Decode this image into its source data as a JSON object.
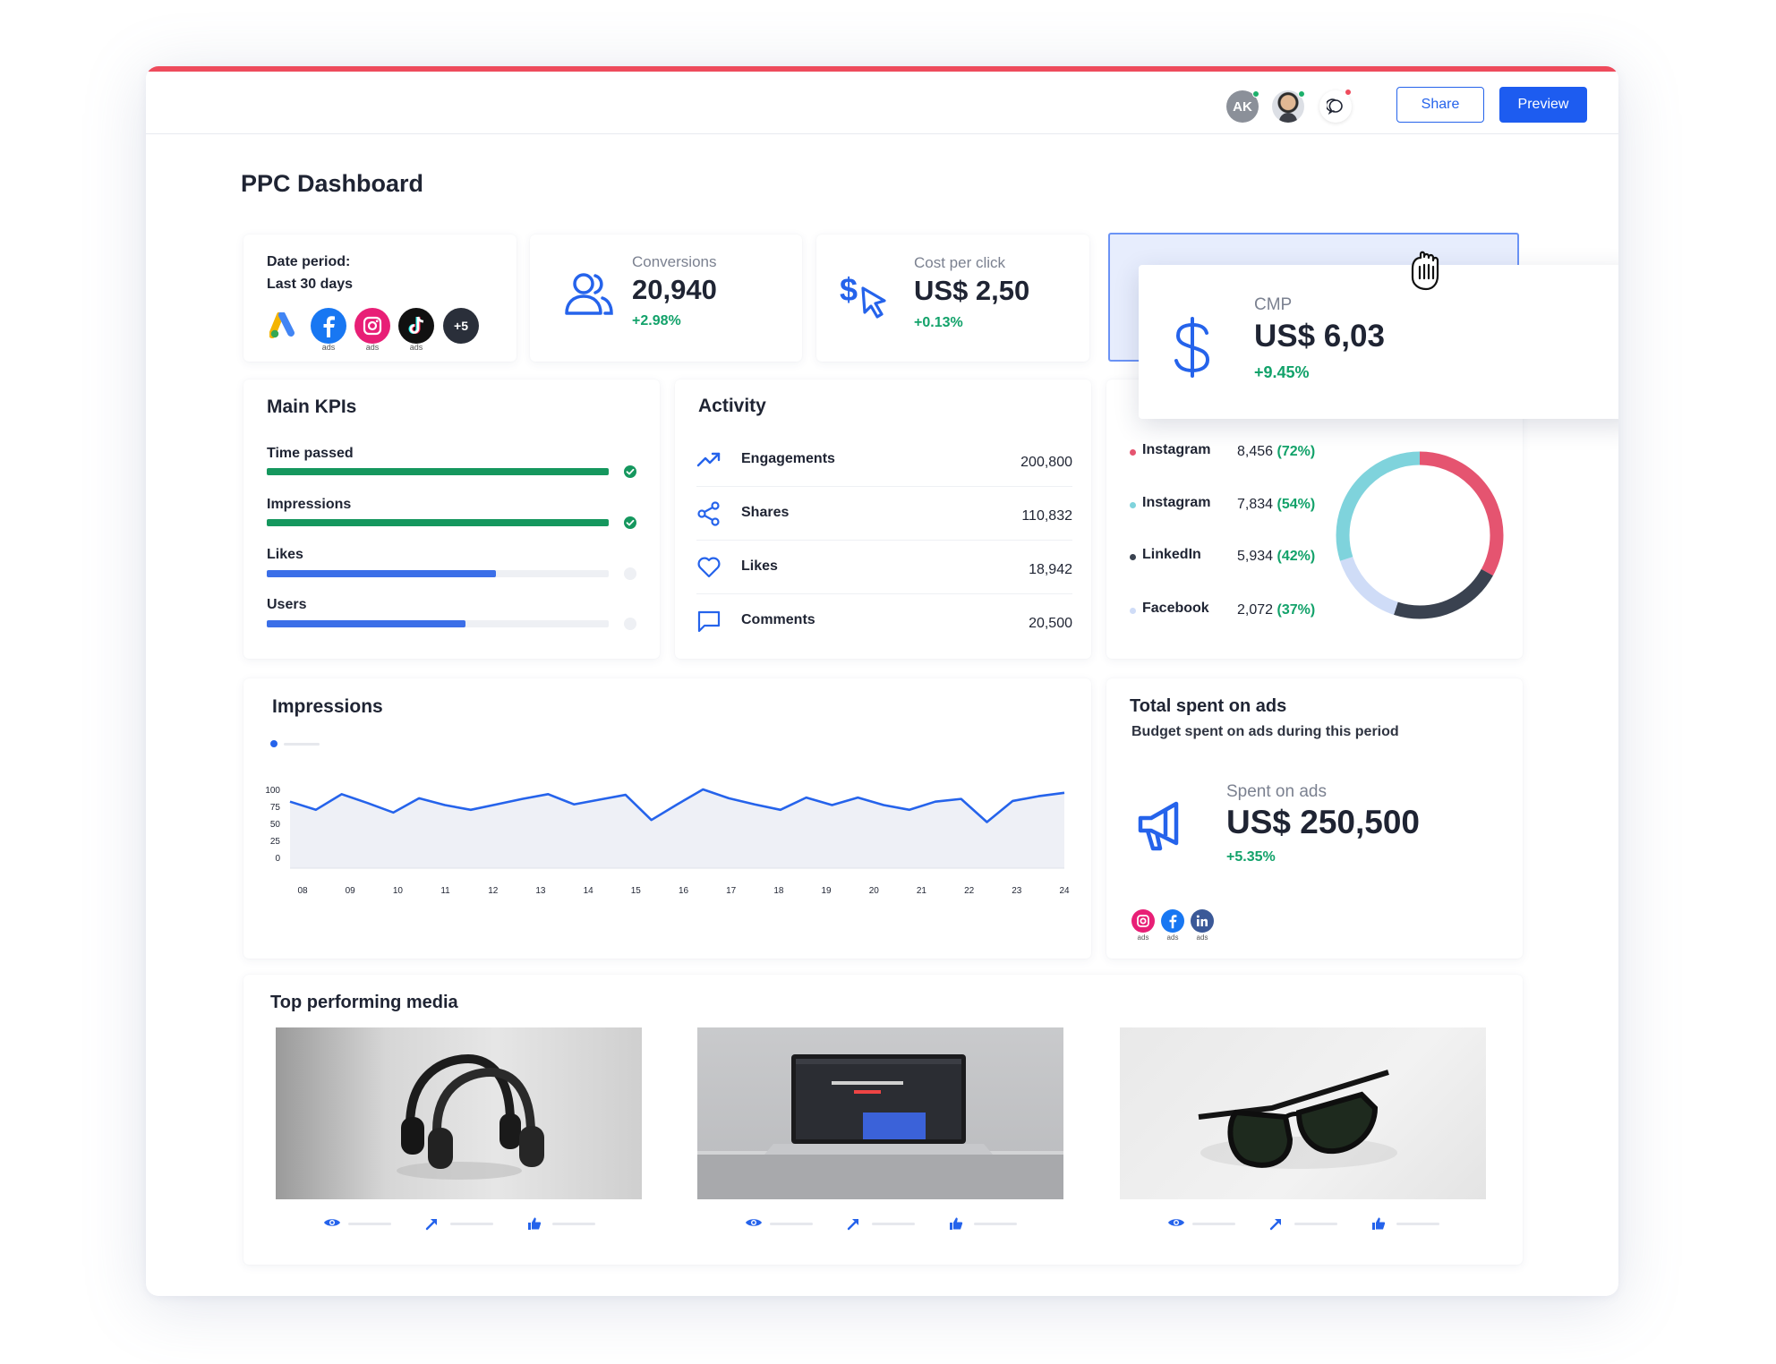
{
  "topbar": {
    "avatar_initials": "AK",
    "share_label": "Share",
    "preview_label": "Preview"
  },
  "page_title": "PPC Dashboard",
  "date_card": {
    "label_line1": "Date period:",
    "label_line2": "Last 30 days",
    "logos": [
      {
        "name": "google-ads-logo",
        "caption": ""
      },
      {
        "name": "facebook-ads-logo",
        "caption": "ads"
      },
      {
        "name": "instagram-ads-logo",
        "caption": "ads"
      },
      {
        "name": "tiktok-ads-logo",
        "caption": "ads"
      }
    ],
    "more_label": "+5"
  },
  "conversions": {
    "label": "Conversions",
    "value": "20,940",
    "delta": "+2.98%"
  },
  "cpc": {
    "label": "Cost per click",
    "value": "US$ 2,50",
    "delta": "+0.13%"
  },
  "cmp": {
    "label": "CMP",
    "value": "US$ 6,03",
    "delta": "+9.45%"
  },
  "main_kpis": {
    "title": "Main KPIs",
    "items": [
      {
        "label": "Time passed",
        "progress": 1.0,
        "color": "#15975e",
        "done": true
      },
      {
        "label": "Impressions",
        "progress": 1.0,
        "color": "#15975e",
        "done": true
      },
      {
        "label": "Likes",
        "progress": 0.67,
        "color": "#3b6fe8",
        "done": false
      },
      {
        "label": "Users",
        "progress": 0.58,
        "color": "#3b6fe8",
        "done": false
      }
    ]
  },
  "activity": {
    "title": "Activity",
    "rows": [
      {
        "label": "Engagements",
        "value": "200,800",
        "icon": "trend-up-icon"
      },
      {
        "label": "Shares",
        "value": "110,832",
        "icon": "share-icon"
      },
      {
        "label": "Likes",
        "value": "18,942",
        "icon": "heart-icon"
      },
      {
        "label": "Comments",
        "value": "20,500",
        "icon": "comment-icon"
      }
    ]
  },
  "channels": {
    "rows": [
      {
        "name": "Instagram",
        "value": "8,456",
        "pct": "(72%)",
        "color": "#e55470"
      },
      {
        "name": "Instagram",
        "value": "7,834",
        "pct": "(54%)",
        "color": "#7fd3dc"
      },
      {
        "name": "LinkedIn",
        "value": "5,934",
        "pct": "(42%)",
        "color": "#3a4250"
      },
      {
        "name": "Facebook",
        "value": "2,072",
        "pct": "(37%)",
        "color": "#cfdcf7"
      }
    ],
    "donut": [
      {
        "color": "#e55470",
        "share": 0.33
      },
      {
        "color": "#3a4250",
        "share": 0.22
      },
      {
        "color": "#cfdcf7",
        "share": 0.15
      },
      {
        "color": "#7fd3dc",
        "share": 0.3
      }
    ]
  },
  "impressions": {
    "title": "Impressions",
    "accent": "#2563eb"
  },
  "chart_data": {
    "type": "area",
    "title": "Impressions",
    "xlabel": "",
    "ylabel": "",
    "ylim": [
      0,
      100
    ],
    "yticks": [
      "100",
      "75",
      "50",
      "25",
      "0"
    ],
    "xticks": [
      "08",
      "09",
      "10",
      "11",
      "12",
      "13",
      "14",
      "15",
      "16",
      "17",
      "18",
      "19",
      "20",
      "21",
      "22",
      "23",
      "24"
    ],
    "series": [
      {
        "values": [
          82,
          70,
          93,
          80,
          66,
          87,
          77,
          70,
          78,
          86,
          93,
          78,
          85,
          92,
          55,
          78,
          100,
          87,
          78,
          70,
          88,
          77,
          88,
          77,
          70,
          82,
          86,
          52,
          83,
          90,
          95
        ]
      }
    ],
    "grid": false
  },
  "total_spent": {
    "title": "Total spent on ads",
    "subtitle": "Budget spent on ads during this period",
    "label": "Spent on ads",
    "value": "US$ 250,500",
    "delta": "+5.35%",
    "logo_caption": "ads"
  },
  "top_media": {
    "title": "Top performing media",
    "items": [
      {
        "name": "headphones-image"
      },
      {
        "name": "laptop-image"
      },
      {
        "name": "sunglasses-image"
      }
    ]
  }
}
